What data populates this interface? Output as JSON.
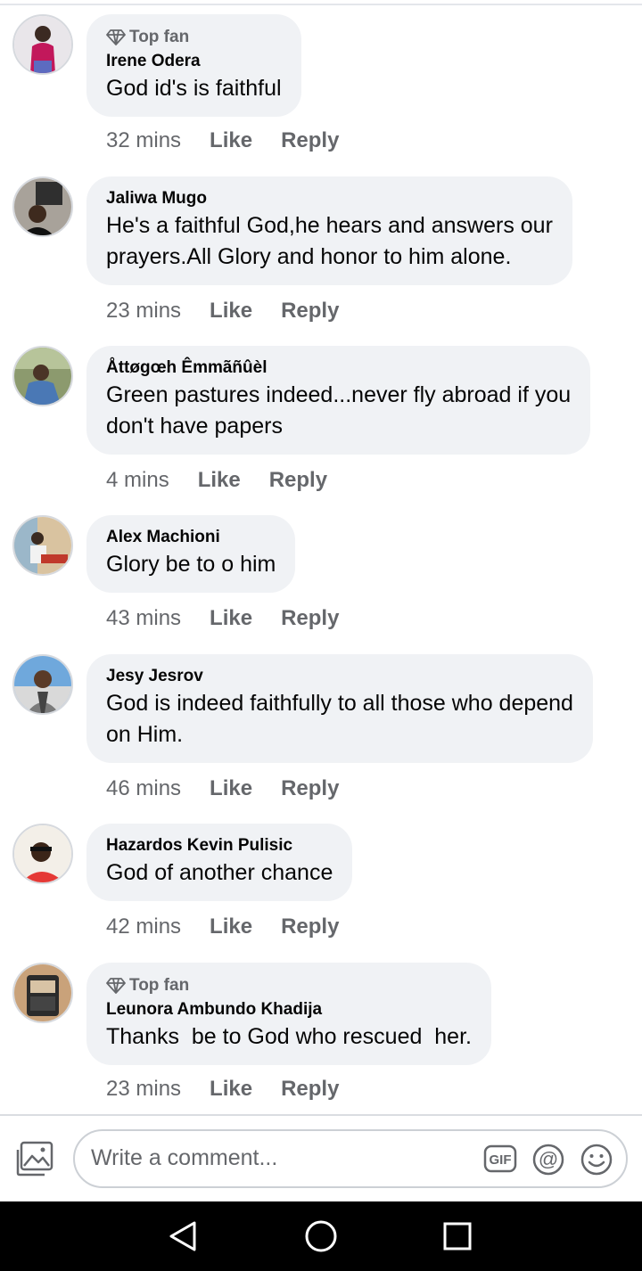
{
  "comments": [
    {
      "badge": "Top fan",
      "author": "Irene Odera",
      "text": "God id's is faithful",
      "time": "32 mins",
      "like_label": "Like",
      "reply_label": "Reply"
    },
    {
      "author": "Jaliwa Mugo",
      "text": "He's a faithful God,he hears and answers our\nprayers.All Glory and honor to him alone.",
      "time": "23 mins",
      "like_label": "Like",
      "reply_label": "Reply"
    },
    {
      "author": "Åttøgœh Êmmãñûèl",
      "text": "Green pastures indeed...never fly abroad if you\ndon't have papers",
      "time": "4 mins",
      "like_label": "Like",
      "reply_label": "Reply"
    },
    {
      "author": "Alex Machioni",
      "text": "Glory be to o him",
      "time": "43 mins",
      "like_label": "Like",
      "reply_label": "Reply"
    },
    {
      "author": "Jesy Jesrov",
      "text": "God is indeed faithfully to all those who depend\non Him.",
      "time": "46 mins",
      "like_label": "Like",
      "reply_label": "Reply"
    },
    {
      "author": "Hazardos Kevin Pulisic",
      "text": "God of another chance",
      "time": "42 mins",
      "like_label": "Like",
      "reply_label": "Reply"
    },
    {
      "badge": "Top fan",
      "author": "Leunora Ambundo Khadija",
      "text": "Thanks  be to God who rescued  her.",
      "time": "23 mins",
      "like_label": "Like",
      "reply_label": "Reply"
    }
  ],
  "composer": {
    "placeholder": "Write a comment...",
    "icons": [
      "photo-icon",
      "gif-icon",
      "mention-icon",
      "emoji-icon"
    ]
  },
  "navbar": {
    "icons": [
      "back-icon",
      "home-icon",
      "recent-apps-icon"
    ]
  },
  "colors": {
    "bubble": "#f0f2f5",
    "secondary_text": "#65676b",
    "primary_text": "#050505",
    "navbar": "#000000"
  }
}
